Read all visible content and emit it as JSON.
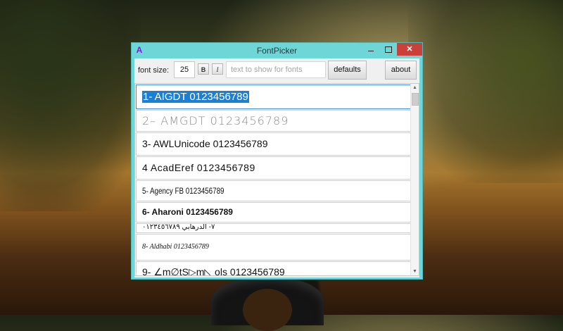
{
  "window": {
    "title": "FontPicker",
    "icon": "font-picker-app-icon"
  },
  "toolbar": {
    "font_size_label": "font size:",
    "font_size_value": "25",
    "bold_label": "B",
    "italic_label": "I",
    "sample_placeholder": "text  to show for fonts",
    "defaults_label": "defaults",
    "about_label": "about"
  },
  "fonts": {
    "items": [
      {
        "label": "1- AIGDT  0123456789",
        "selected": true
      },
      {
        "label": "2–  AMGDT   0123456789"
      },
      {
        "label": "3- AWLUnicode  0123456789"
      },
      {
        "label": "4  AcadEref  0123456789"
      },
      {
        "label": "5- Agency FB  0123456789"
      },
      {
        "label": "6- Aharoni   0123456789"
      },
      {
        "label": "٧- الدرهابي  ٠١٢٣٤٥٦٧٨٩"
      },
      {
        "label": "8- Aldhabi  0123456789"
      },
      {
        "label": "9-  ∠m∅tS▷m◺ ols   0123456789"
      }
    ]
  },
  "colors": {
    "window_frame": "#6fd6d8",
    "selection": "#1c7fd4",
    "close_button": "#c9413a"
  }
}
